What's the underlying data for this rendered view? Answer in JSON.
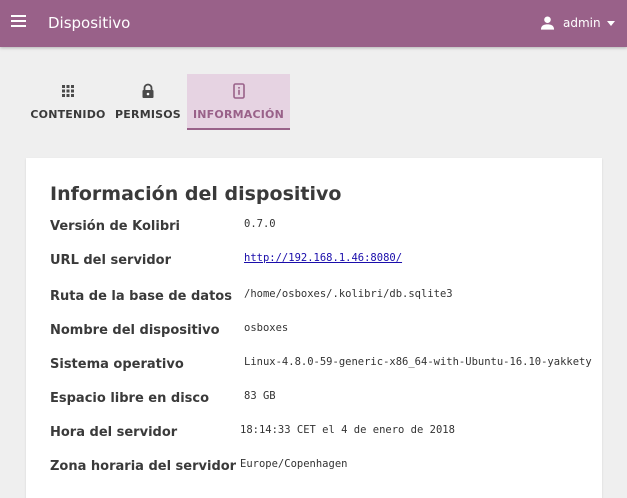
{
  "colors": {
    "brand": "#996189",
    "tab_active_bg": "#e6d3e2",
    "background": "#efefef",
    "link": "#1a0dab"
  },
  "appbar": {
    "menu_icon": "hamburger-menu-icon",
    "title": "Dispositivo",
    "user_icon": "person-icon",
    "username": "admin",
    "caret_icon": "caret-down-icon"
  },
  "tabs": [
    {
      "label": "CONTENIDO",
      "icon": "grid-dots-icon",
      "active": false
    },
    {
      "label": "PERMISOS",
      "icon": "lock-icon",
      "active": false
    },
    {
      "label": "INFORMACIÓN",
      "icon": "device-info-icon",
      "active": true
    }
  ],
  "info": {
    "title": "Información del dispositivo",
    "rows": [
      {
        "label": "Versión de Kolibri",
        "value": "0.7.0"
      },
      {
        "label": "URL del servidor",
        "value": "http://192.168.1.46:8080/"
      },
      {
        "label": "Ruta de la base de datos",
        "value": "/home/osboxes/.kolibri/db.sqlite3"
      },
      {
        "label": "Nombre del dispositivo",
        "value": "osboxes"
      },
      {
        "label": "Sistema operativo",
        "value": "Linux-4.8.0-59-generic-x86_64-with-Ubuntu-16.10-yakkety"
      },
      {
        "label": "Espacio libre en disco",
        "value": "83 GB"
      },
      {
        "label": "Hora del servidor",
        "value": "18:14:33 CET el 4 de enero de 2018"
      },
      {
        "label": "Zona horaria del servidor",
        "value": "Europe/Copenhagen"
      }
    ]
  }
}
